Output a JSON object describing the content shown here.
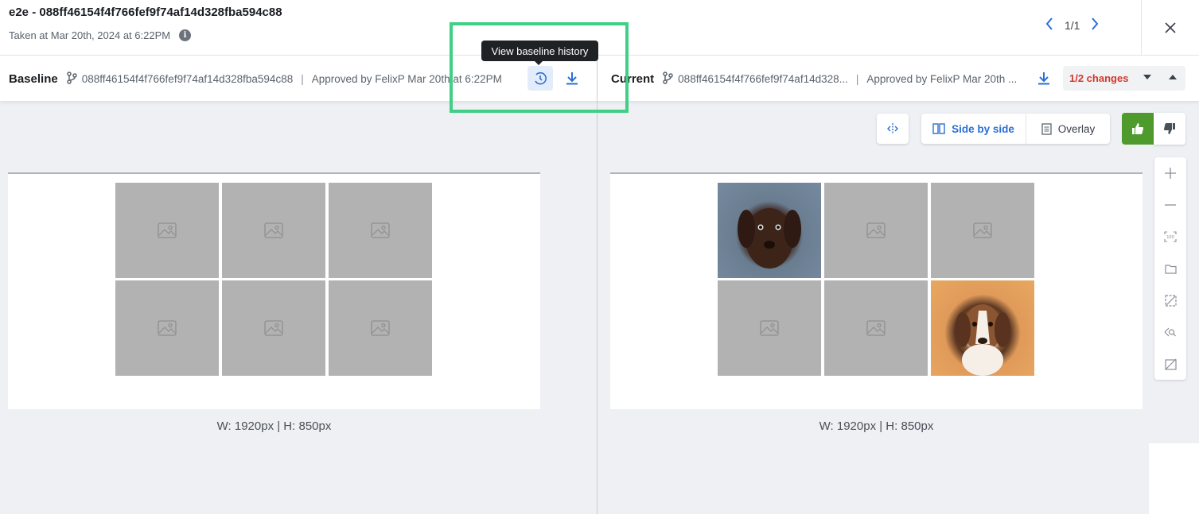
{
  "header": {
    "title": "e2e - 088ff46154f4f766fef9f74af14d328fba594c88",
    "subtitle": "Taken at Mar 20th, 2024 at 6:22PM",
    "pager": "1/1"
  },
  "baseline": {
    "label": "Baseline",
    "hash": "088ff46154f4f766fef9f74af14d328fba594c88",
    "approved": "Approved by FelixP Mar 20th at 6:22PM",
    "dims": "W: 1920px | H: 850px"
  },
  "current": {
    "label": "Current",
    "hash": "088ff46154f4f766fef9f74af14d328...",
    "approved": "Approved by FelixP Mar 20th ...",
    "dims": "W: 1920px | H: 850px",
    "changes": "1/2 changes"
  },
  "tooltip": "View baseline history",
  "view_toggle": {
    "side_by_side": "Side by side",
    "overlay": "Overlay"
  },
  "colors": {
    "accent": "#2a6fd6",
    "highlight": "#3fcf87",
    "approve": "#4f9a2d",
    "changes": "#d1392b"
  },
  "icons": [
    "info-icon",
    "branch-icon",
    "history-icon",
    "download-icon",
    "chevron-left-icon",
    "chevron-right-icon",
    "close-icon",
    "split-icon",
    "side-by-side-icon",
    "overlay-icon",
    "thumbs-up-icon",
    "thumbs-down-icon",
    "zoom-in-icon",
    "zoom-out-icon",
    "actual-size-icon",
    "folder-icon",
    "ignore-region-icon",
    "search-region-icon",
    "hide-diff-icon",
    "image-placeholder-icon"
  ]
}
